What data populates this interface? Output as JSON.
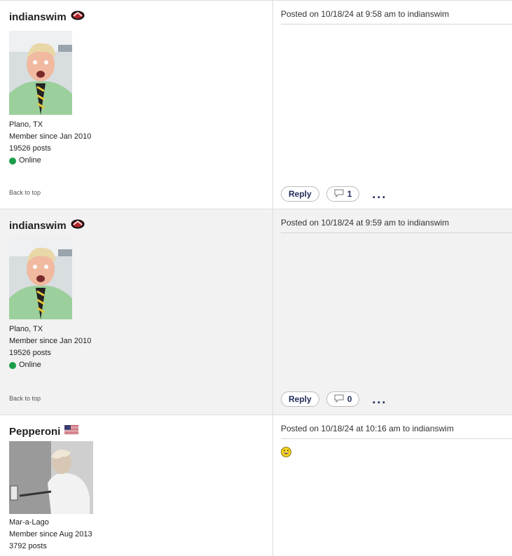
{
  "posts": [
    {
      "username": "indianswim",
      "badge_icon": "team-logo-icon",
      "location": "Plano, TX",
      "member_since": "Member since Jan 2010",
      "post_count": "19526 posts",
      "status": "Online",
      "back_to_top": "Back to top",
      "posted": "Posted on 10/18/24 at 9:58 am to indianswim",
      "reply_label": "Reply",
      "comment_count": "1",
      "more_label": "..."
    },
    {
      "username": "indianswim",
      "badge_icon": "team-logo-icon",
      "location": "Plano, TX",
      "member_since": "Member since Jan 2010",
      "post_count": "19526 posts",
      "status": "Online",
      "back_to_top": "Back to top",
      "posted": "Posted on 10/18/24 at 9:59 am to indianswim",
      "reply_label": "Reply",
      "comment_count": "0",
      "more_label": "..."
    },
    {
      "username": "Pepperoni",
      "badge_icon": "us-flag-icon",
      "location": "Mar-a-Lago",
      "member_since": "Member since Aug 2013",
      "post_count": "3792 posts",
      "posted": "Posted on 10/18/24 at 10:16 am to indianswim",
      "body_icon": "laughing-emoji-icon"
    }
  ]
}
